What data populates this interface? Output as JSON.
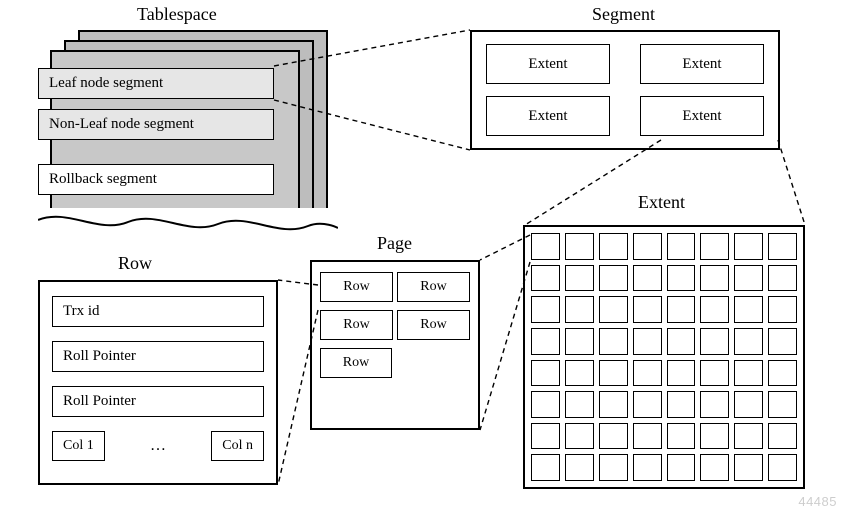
{
  "labels": {
    "tablespace": "Tablespace",
    "segment": "Segment",
    "extent": "Extent",
    "page": "Page",
    "row": "Row"
  },
  "tablespace": {
    "segments": [
      "Leaf node segment",
      "Non-Leaf node segment",
      "Rollback segment"
    ]
  },
  "segment": {
    "cells": [
      "Extent",
      "Extent",
      "Extent",
      "Extent"
    ]
  },
  "extent": {
    "grid_rows": 8,
    "grid_cols": 8
  },
  "page": {
    "rows": [
      [
        "Row",
        "Row"
      ],
      [
        "Row",
        "Row"
      ],
      [
        "Row"
      ]
    ]
  },
  "row": {
    "fields": [
      "Trx id",
      "Roll Pointer",
      "Roll Pointer"
    ],
    "col_first": "Col 1",
    "col_ellipsis": "…",
    "col_last": "Col n"
  },
  "watermark": "44485"
}
